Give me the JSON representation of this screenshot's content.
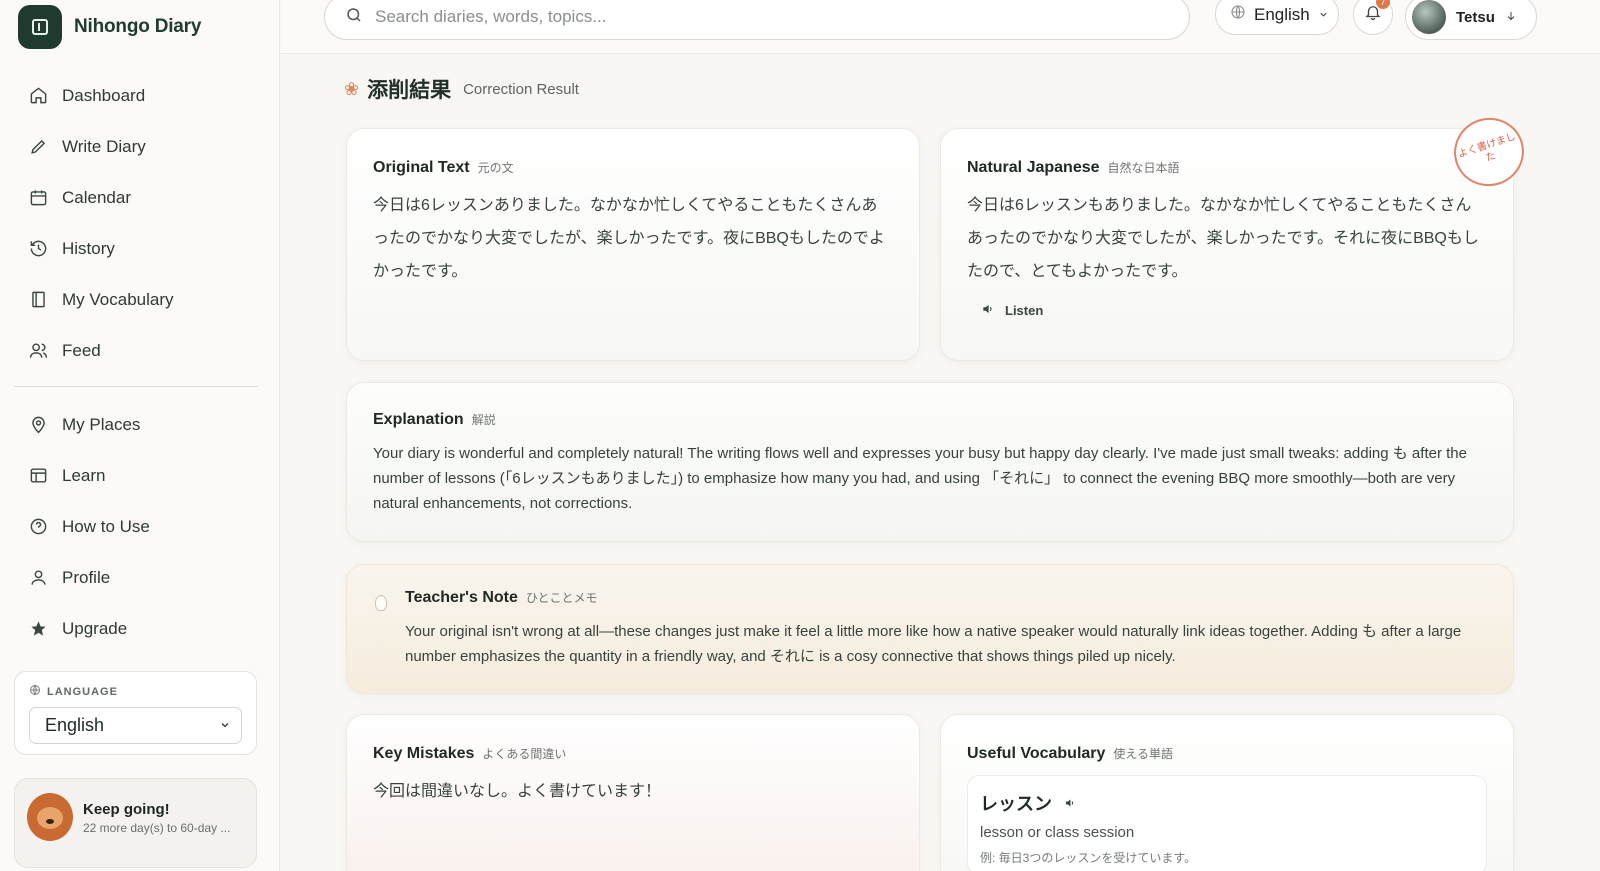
{
  "brand": {
    "name": "Nihongo Diary"
  },
  "nav": {
    "items": [
      {
        "id": "dashboard",
        "label": "Dashboard",
        "icon": "home-icon"
      },
      {
        "id": "write-diary",
        "label": "Write Diary",
        "icon": "pencil-icon"
      },
      {
        "id": "calendar",
        "label": "Calendar",
        "icon": "calendar-icon"
      },
      {
        "id": "history",
        "label": "History",
        "icon": "history-icon"
      },
      {
        "id": "my-vocabulary",
        "label": "My Vocabulary",
        "icon": "book-icon"
      },
      {
        "id": "feed",
        "label": "Feed",
        "icon": "users-icon"
      }
    ],
    "secondary": [
      {
        "id": "my-places",
        "label": "My Places",
        "icon": "pin-icon"
      },
      {
        "id": "learn",
        "label": "Learn",
        "icon": "layout-icon"
      },
      {
        "id": "how-to-use",
        "label": "How to Use",
        "icon": "help-icon"
      },
      {
        "id": "profile",
        "label": "Profile",
        "icon": "user-icon"
      },
      {
        "id": "upgrade",
        "label": "Upgrade",
        "icon": "star-icon"
      }
    ]
  },
  "language_card": {
    "title": "LANGUAGE",
    "selected": "English"
  },
  "streak": {
    "title": "Keep going!",
    "subtitle": "22 more day(s) to 60-day ..."
  },
  "topbar": {
    "search_placeholder": "Search diaries, words, topics...",
    "language": "English",
    "notification_count": "7",
    "user_name": "Tetsu"
  },
  "page": {
    "title_jp": "添削結果",
    "title_en": "Correction Result"
  },
  "original": {
    "title": "Original Text",
    "subtitle": "元の文",
    "text": "今日は6レッスンありました。なかなか忙しくてやることもたくさんあったのでかなり大変でしたが、楽しかったです。夜にBBQもしたのでよかったです。"
  },
  "natural": {
    "title": "Natural Japanese",
    "subtitle": "自然な日本語",
    "text": "今日は6レッスンもありました。なかなか忙しくてやることもたくさんあったのでかなり大変でしたが、楽しかったです。それに夜にBBQもしたので、とてもよかったです。",
    "listen_label": "Listen",
    "stamp": "よく書けました"
  },
  "explanation": {
    "title": "Explanation",
    "subtitle": "解説",
    "text": "Your diary is wonderful and completely natural! The writing flows well and expresses your busy but happy day clearly. I've made just small tweaks: adding も after the number of lessons (「6レッスンもありました」) to emphasize how many you had, and using 「それに」 to connect the evening BBQ more smoothly—both are very natural enhancements, not corrections."
  },
  "teacher_note": {
    "title": "Teacher's Note",
    "subtitle": "ひとことメモ",
    "text": "Your original isn't wrong at all—these changes just make it feel a little more like how a native speaker would naturally link ideas together. Adding も after a large number emphasizes the quantity in a friendly way, and それに is a cosy connective that shows things piled up nicely."
  },
  "mistakes": {
    "title": "Key Mistakes",
    "subtitle": "よくある間違い",
    "text": "今回は間違いなし。よく書けています！"
  },
  "vocabulary": {
    "title": "Useful Vocabulary",
    "subtitle": "使える単語",
    "items": [
      {
        "word": "レッスン",
        "meaning": "lesson or class session",
        "example": "例: 毎日3つのレッスンを受けています。"
      }
    ]
  },
  "colors": {
    "brand": "#1f3b30",
    "accent": "#e0784a",
    "note_bg": "#f5ecdd"
  }
}
